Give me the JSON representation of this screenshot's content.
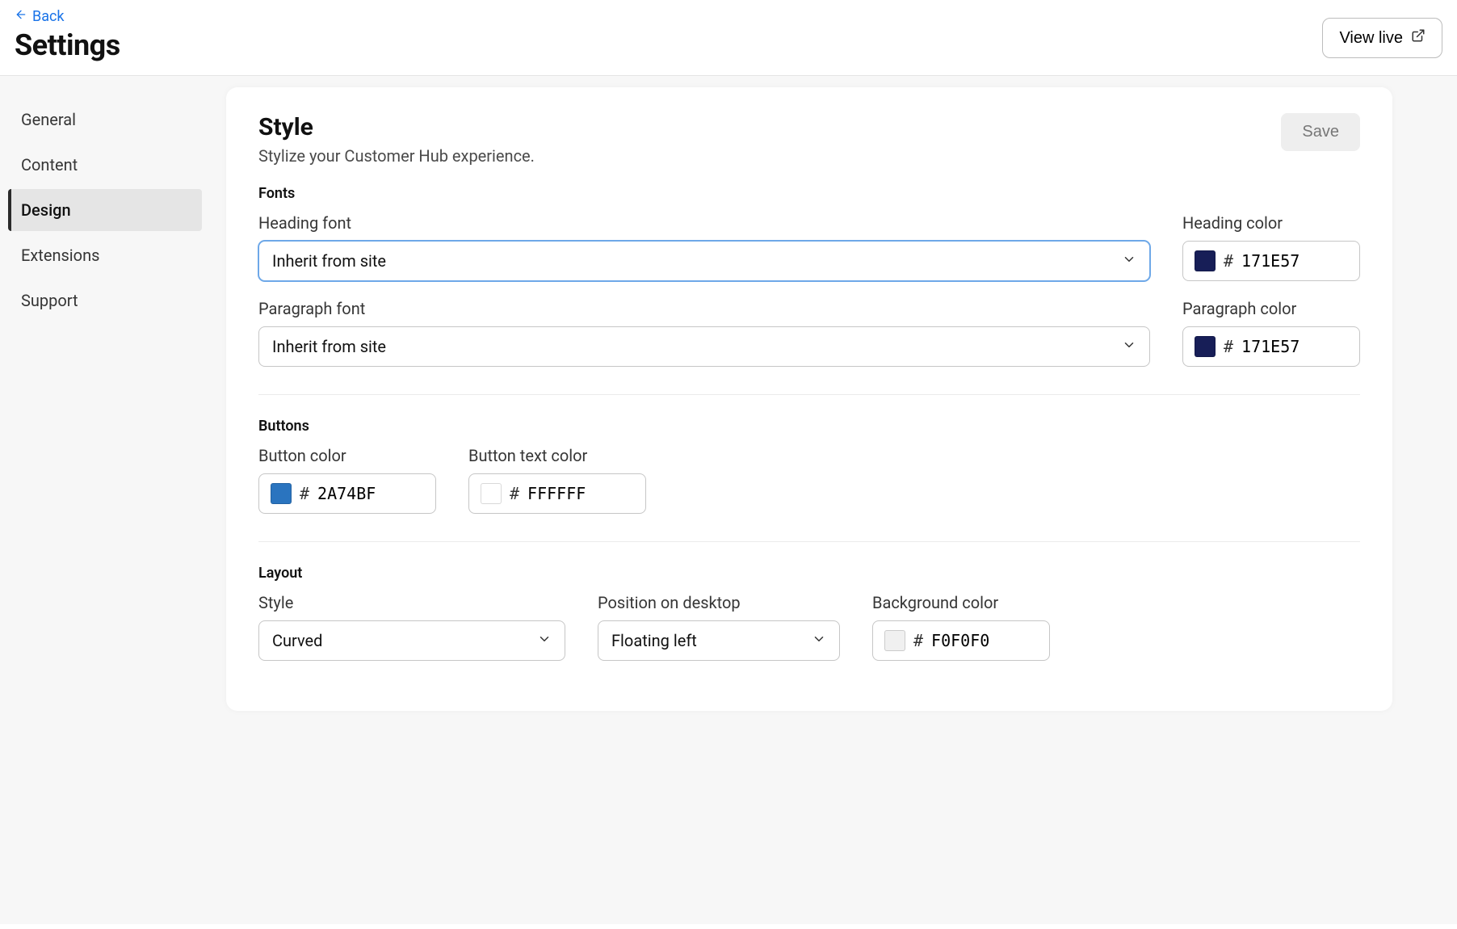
{
  "header": {
    "back_label": "Back",
    "title": "Settings",
    "view_live_label": "View live"
  },
  "sidebar": {
    "items": [
      {
        "label": "General"
      },
      {
        "label": "Content"
      },
      {
        "label": "Design"
      },
      {
        "label": "Extensions"
      },
      {
        "label": "Support"
      }
    ],
    "active_index": 2
  },
  "panel": {
    "title": "Style",
    "subtitle": "Stylize your Customer Hub experience.",
    "save_label": "Save"
  },
  "fonts": {
    "section_label": "Fonts",
    "heading_font_label": "Heading font",
    "heading_font_value": "Inherit from site",
    "heading_color_label": "Heading color",
    "heading_color_value": "171E57",
    "heading_color_hex": "#171E57",
    "paragraph_font_label": "Paragraph font",
    "paragraph_font_value": "Inherit from site",
    "paragraph_color_label": "Paragraph color",
    "paragraph_color_value": "171E57",
    "paragraph_color_hex": "#171E57"
  },
  "buttons": {
    "section_label": "Buttons",
    "button_color_label": "Button color",
    "button_color_value": "2A74BF",
    "button_color_hex": "#2A74BF",
    "button_text_color_label": "Button text color",
    "button_text_color_value": "FFFFFF",
    "button_text_color_hex": "#FFFFFF"
  },
  "layout": {
    "section_label": "Layout",
    "style_label": "Style",
    "style_value": "Curved",
    "position_label": "Position on desktop",
    "position_value": "Floating left",
    "background_color_label": "Background color",
    "background_color_value": "F0F0F0",
    "background_color_hex": "#F0F0F0"
  }
}
